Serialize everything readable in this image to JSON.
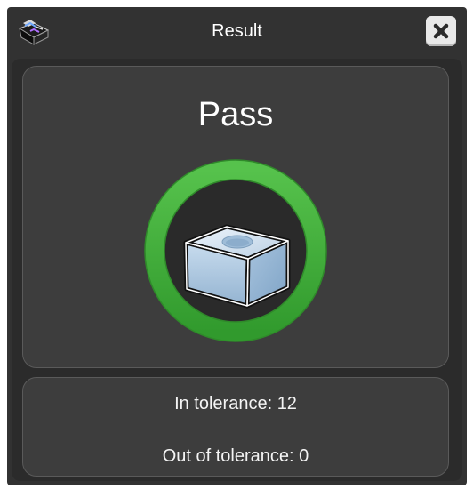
{
  "window": {
    "title": "Result",
    "app_icon": "inspection-box-icon",
    "close_icon": "close-icon"
  },
  "result": {
    "status": "Pass",
    "status_color": "#3fad3a",
    "part_icon": "part-block-icon"
  },
  "stats": {
    "in_tolerance": "In tolerance: 12",
    "out_of_tolerance": "Out of tolerance: 0"
  }
}
